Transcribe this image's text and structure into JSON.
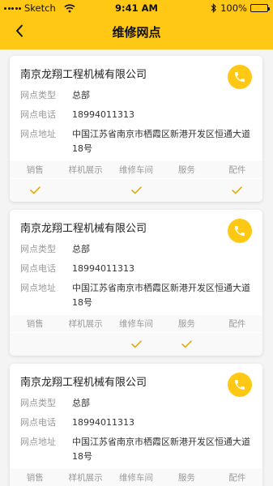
{
  "status_bar": {
    "carrier": "Sketch",
    "time": "9:41 AM",
    "battery": "100%"
  },
  "nav": {
    "title": "维修网点"
  },
  "service_columns": [
    "销售",
    "样机展示",
    "维修车间",
    "服务",
    "配件"
  ],
  "labels": {
    "type": "网点类型",
    "phone": "网点电话",
    "address": "网点地址"
  },
  "dealers": [
    {
      "name": "南京龙翔工程机械有限公司",
      "type": "总部",
      "phone": "18994011313",
      "address": "中国江苏省南京市栖霞区新港开发区恒通大道18号",
      "services": [
        true,
        false,
        true,
        false,
        true
      ]
    },
    {
      "name": "南京龙翔工程机械有限公司",
      "type": "总部",
      "phone": "18994011313",
      "address": "中国江苏省南京市栖霞区新港开发区恒通大道18号",
      "services": [
        false,
        false,
        true,
        true,
        false
      ]
    },
    {
      "name": "南京龙翔工程机械有限公司",
      "type": "总部",
      "phone": "18994011313",
      "address": "中国江苏省南京市栖霞区新港开发区恒通大道18号",
      "services": [
        false,
        false,
        false,
        false,
        false
      ]
    }
  ],
  "colors": {
    "accent": "#ffc814",
    "check": "#e8a800"
  }
}
